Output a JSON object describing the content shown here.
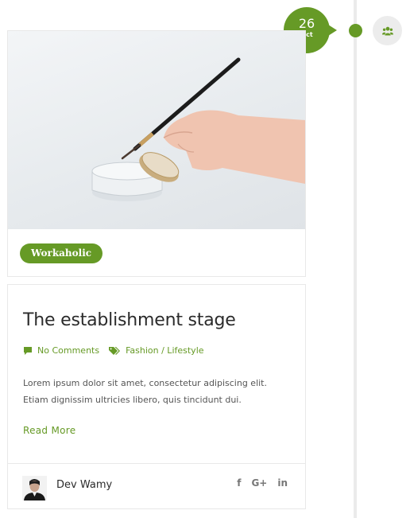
{
  "date": {
    "day": "26",
    "month": "Oct"
  },
  "post_type_icon": "group-icon",
  "category": {
    "label": "Workaholic"
  },
  "post": {
    "title": "The establishment stage",
    "comments_label": "No Comments",
    "categories_label": "Fashion / Lifestyle",
    "excerpt": "Lorem ipsum dolor sit amet, consectetur adipiscing elit. Etiam dignissim ultricies libero, quis tincidunt dui.",
    "read_more": "Read More"
  },
  "author": {
    "name": "Dev Wamy"
  },
  "share": [
    {
      "icon": "facebook-icon",
      "label": "f"
    },
    {
      "icon": "google-plus-icon",
      "label": "G+"
    },
    {
      "icon": "linkedin-icon",
      "label": "in"
    }
  ],
  "colors": {
    "accent": "#669a26",
    "border": "#e8e8e8",
    "timeline": "#ebebeb"
  }
}
